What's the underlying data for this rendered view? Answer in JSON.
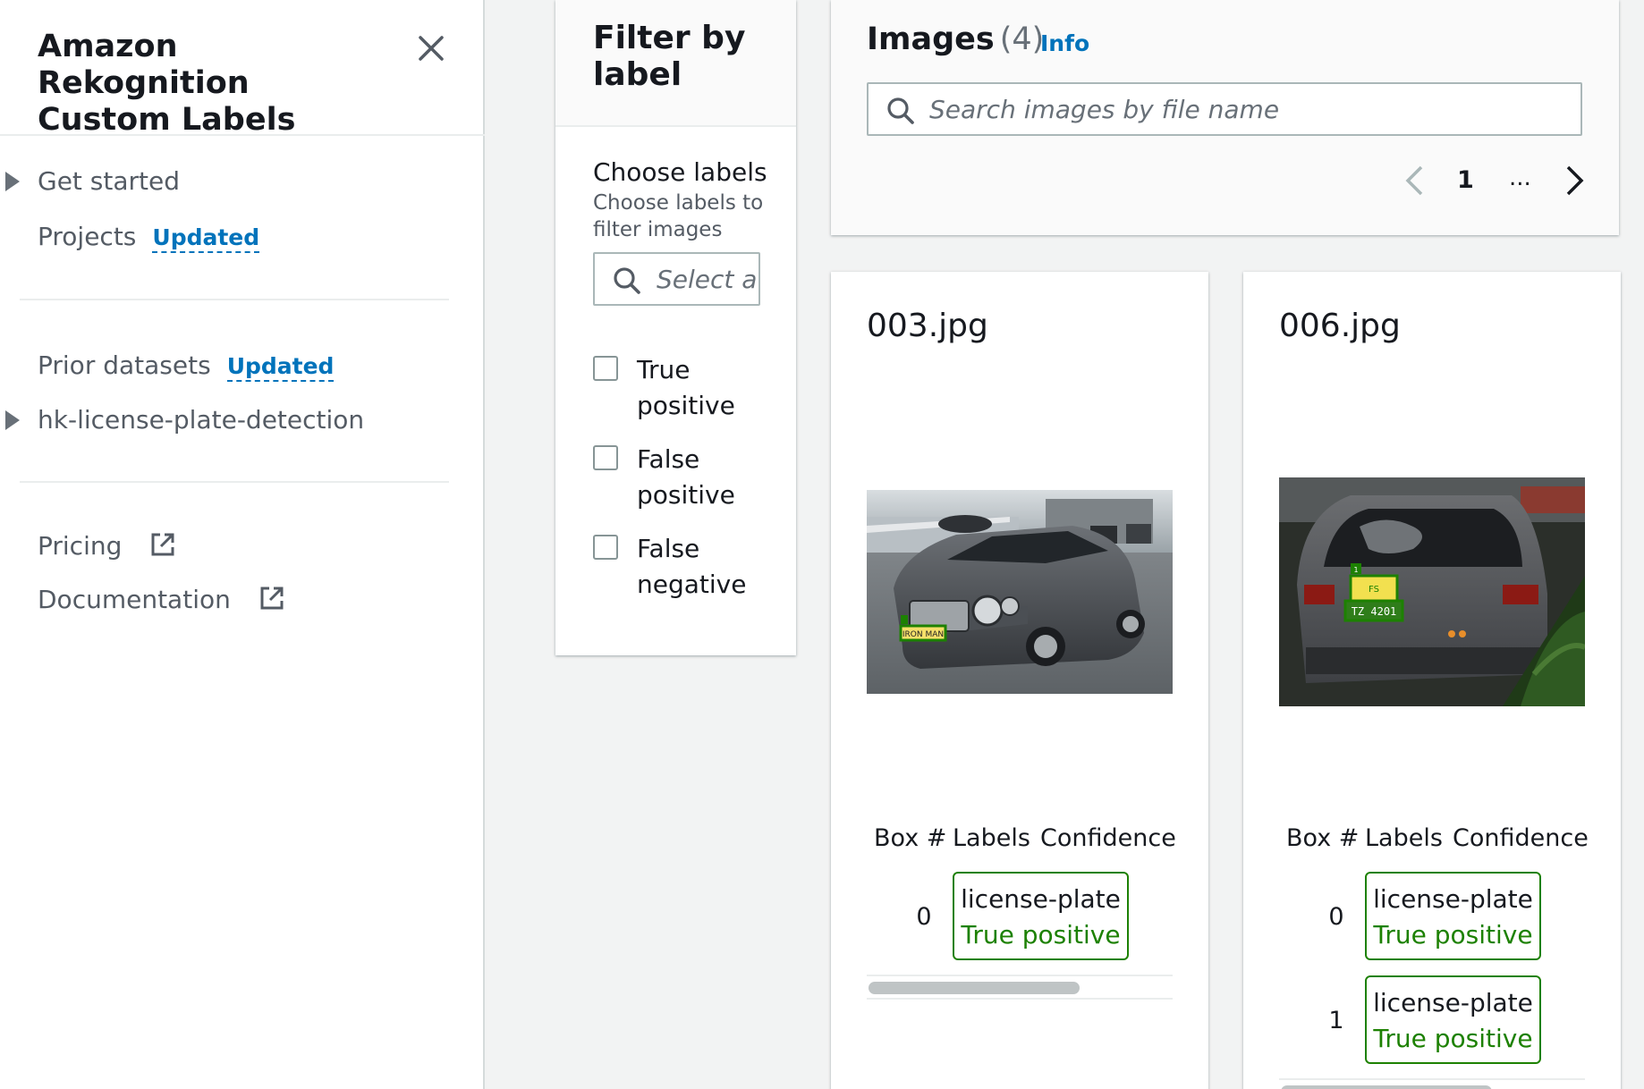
{
  "sidenav": {
    "title": "Amazon Rekognition Custom Labels",
    "items": {
      "get_started": "Get started",
      "projects": "Projects",
      "projects_badge": "Updated",
      "prior_datasets": "Prior datasets",
      "prior_datasets_badge": "Updated",
      "dataset": "hk-license-plate-detection",
      "pricing": "Pricing",
      "documentation": "Documentation"
    }
  },
  "filter": {
    "title": "Filter by label",
    "choose_title": "Choose labels",
    "choose_desc": "Choose labels to filter images",
    "select_placeholder": "Select a",
    "options": [
      "True positive",
      "False positive",
      "False negative"
    ]
  },
  "images": {
    "title": "Images",
    "count": "(4)",
    "info": "Info",
    "search_placeholder": "Search images by file name",
    "page": "1",
    "ellipsis": "..."
  },
  "cards": [
    {
      "filename": "003.jpg",
      "headers": [
        "Box #",
        "Labels",
        "Confidence"
      ],
      "rows": [
        {
          "box": "0",
          "label": "license-plate",
          "status": "True positive"
        }
      ],
      "plate_text": "IRON MAN"
    },
    {
      "filename": "006.jpg",
      "headers": [
        "Box #",
        "Labels",
        "Confidence"
      ],
      "rows": [
        {
          "box": "0",
          "label": "license-plate",
          "status": "True positive"
        },
        {
          "box": "1",
          "label": "license-plate",
          "status": "True positive"
        }
      ],
      "plate_text": "FS",
      "plate_text_2": "TZ 4201",
      "box_tag": "1"
    }
  ],
  "colors": {
    "accent_link": "#0073bb",
    "true_positive": "#1d8102",
    "page_bg": "#f2f3f3"
  }
}
